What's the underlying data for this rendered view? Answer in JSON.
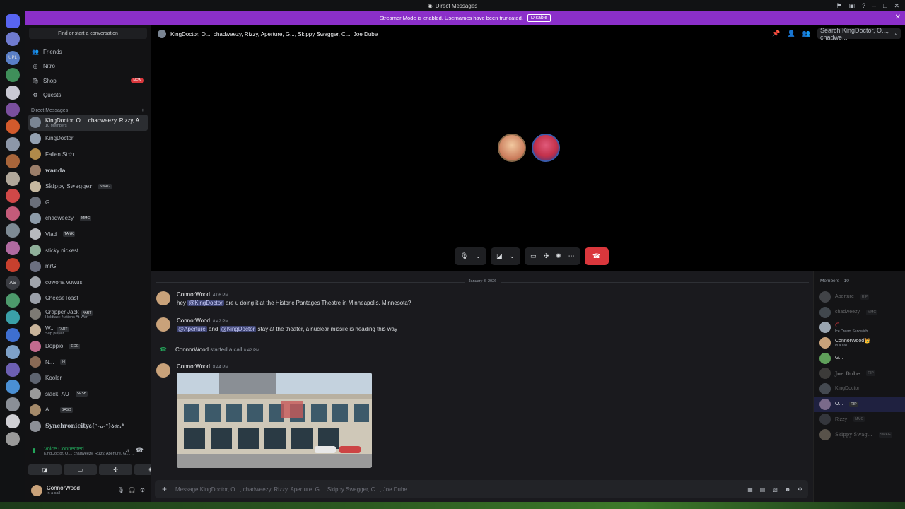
{
  "window": {
    "title": "Direct Messages"
  },
  "banner": {
    "text": "Streamer Mode is enabled. Usernames have been truncated.",
    "button": "Disable"
  },
  "guilds": {
    "as_label": "AS",
    "upl_label": "UPL"
  },
  "dm_sidebar": {
    "search_placeholder": "Find or start a conversation",
    "nav": [
      {
        "label": "Friends",
        "icon": "friends-icon"
      },
      {
        "label": "Nitro",
        "icon": "nitro-icon"
      },
      {
        "label": "Shop",
        "icon": "shop-icon",
        "badge": "NEW"
      },
      {
        "label": "Quests",
        "icon": "quests-icon"
      }
    ],
    "section_label": "Direct Messages",
    "section_add": "+",
    "dms": [
      {
        "name": "KingDoctor, O..., chadweezy, Rizzy, A...",
        "sub": "10 Members",
        "active": true
      },
      {
        "name": "KingDoctor"
      },
      {
        "name": "Fallen St☆r"
      },
      {
        "name": "wanda"
      },
      {
        "name": "Skippy Swagger",
        "tag": "SWAG"
      },
      {
        "name": "G..."
      },
      {
        "name": "chadweezy",
        "tag": "MMC"
      },
      {
        "name": "Vlad",
        "tag": "TANK"
      },
      {
        "name": "sticky nickest"
      },
      {
        "name": "mrG"
      },
      {
        "name": "cowona vuwus"
      },
      {
        "name": "CheeseToast"
      },
      {
        "name": "Crapper Jack",
        "tag": "FART",
        "sub": "Holdfast: Nations At War"
      },
      {
        "name": "W...",
        "tag": "FART",
        "sub": "Sup player"
      },
      {
        "name": "Doppio",
        "tag": "EGG"
      },
      {
        "name": "N...",
        "tag": "I-I"
      },
      {
        "name": "Kooler"
      },
      {
        "name": "slack_AU",
        "tag": "SESH"
      },
      {
        "name": "A...",
        "tag": "BASD"
      },
      {
        "name": "Synchronicity૮(ᵔ-ᴗ-ᵔ)ა☆.*"
      }
    ],
    "voice": {
      "status": "Voice Connected",
      "channel": "KingDoctor, O..., chadweezy, Rizzy, Aperture, G..., ..."
    },
    "user": {
      "name": "ConnorWood",
      "status": "In a call"
    }
  },
  "call_header": {
    "title": "KingDoctor, O..., chadweezy, Rizzy, Aperture, G..., Skippy Swagger, C..., Joe Dube",
    "search_placeholder": "Search KingDoctor, O..., chadwe..."
  },
  "chat": {
    "date": "January 3, 2026",
    "messages": [
      {
        "author": "ConnorWood",
        "time": "4:06 PM",
        "pre": "hey ",
        "mention1": "@KingDoctor",
        "post": " are u doing it at the Historic Pantages Theatre in Minneapolis, Minnesota?"
      },
      {
        "author": "ConnorWood",
        "time": "8:42 PM",
        "mention1": "@Aperture",
        "mid": " and ",
        "mention2": "@KingDoctor",
        "post": " stay at the theater, a nuclear missile is heading this way"
      },
      {
        "author": "ConnorWood",
        "time": "8:44 PM"
      }
    ],
    "system": {
      "author": "ConnorWood",
      "text": " started a call.",
      "time": "8:42 PM"
    },
    "composer_placeholder": "Message KingDoctor, O..., chadweezy, Rizzy, Aperture, G..., Skippy Swagger, C..., Joe Dube"
  },
  "members": {
    "header": "Members—10",
    "list": [
      {
        "name": "Aperture",
        "tag": "RIP",
        "offline": true
      },
      {
        "name": "chadweezy",
        "tag": "MMC",
        "offline": true
      },
      {
        "name": "",
        "sub": "Ice Cream Sandwich",
        "offline": false
      },
      {
        "name": "ConnorWood",
        "crown": "👑",
        "sub": "In a call",
        "offline": false
      },
      {
        "name": "G...",
        "offline": false
      },
      {
        "name": "Joe Dube",
        "tag": "RIP",
        "offline": true
      },
      {
        "name": "KingDoctor",
        "offline": true
      },
      {
        "name": "O...",
        "tag": "RIP",
        "offline": false,
        "selected": true
      },
      {
        "name": "Rizzy",
        "tag": "MMC",
        "offline": true
      },
      {
        "name": "Skippy Swag...",
        "tag": "SWAG",
        "offline": true
      }
    ]
  },
  "colors": {
    "accent": "#8b2fc9",
    "online": "#23a55a",
    "danger": "#da373c",
    "mention_bg": "#3c4270"
  }
}
